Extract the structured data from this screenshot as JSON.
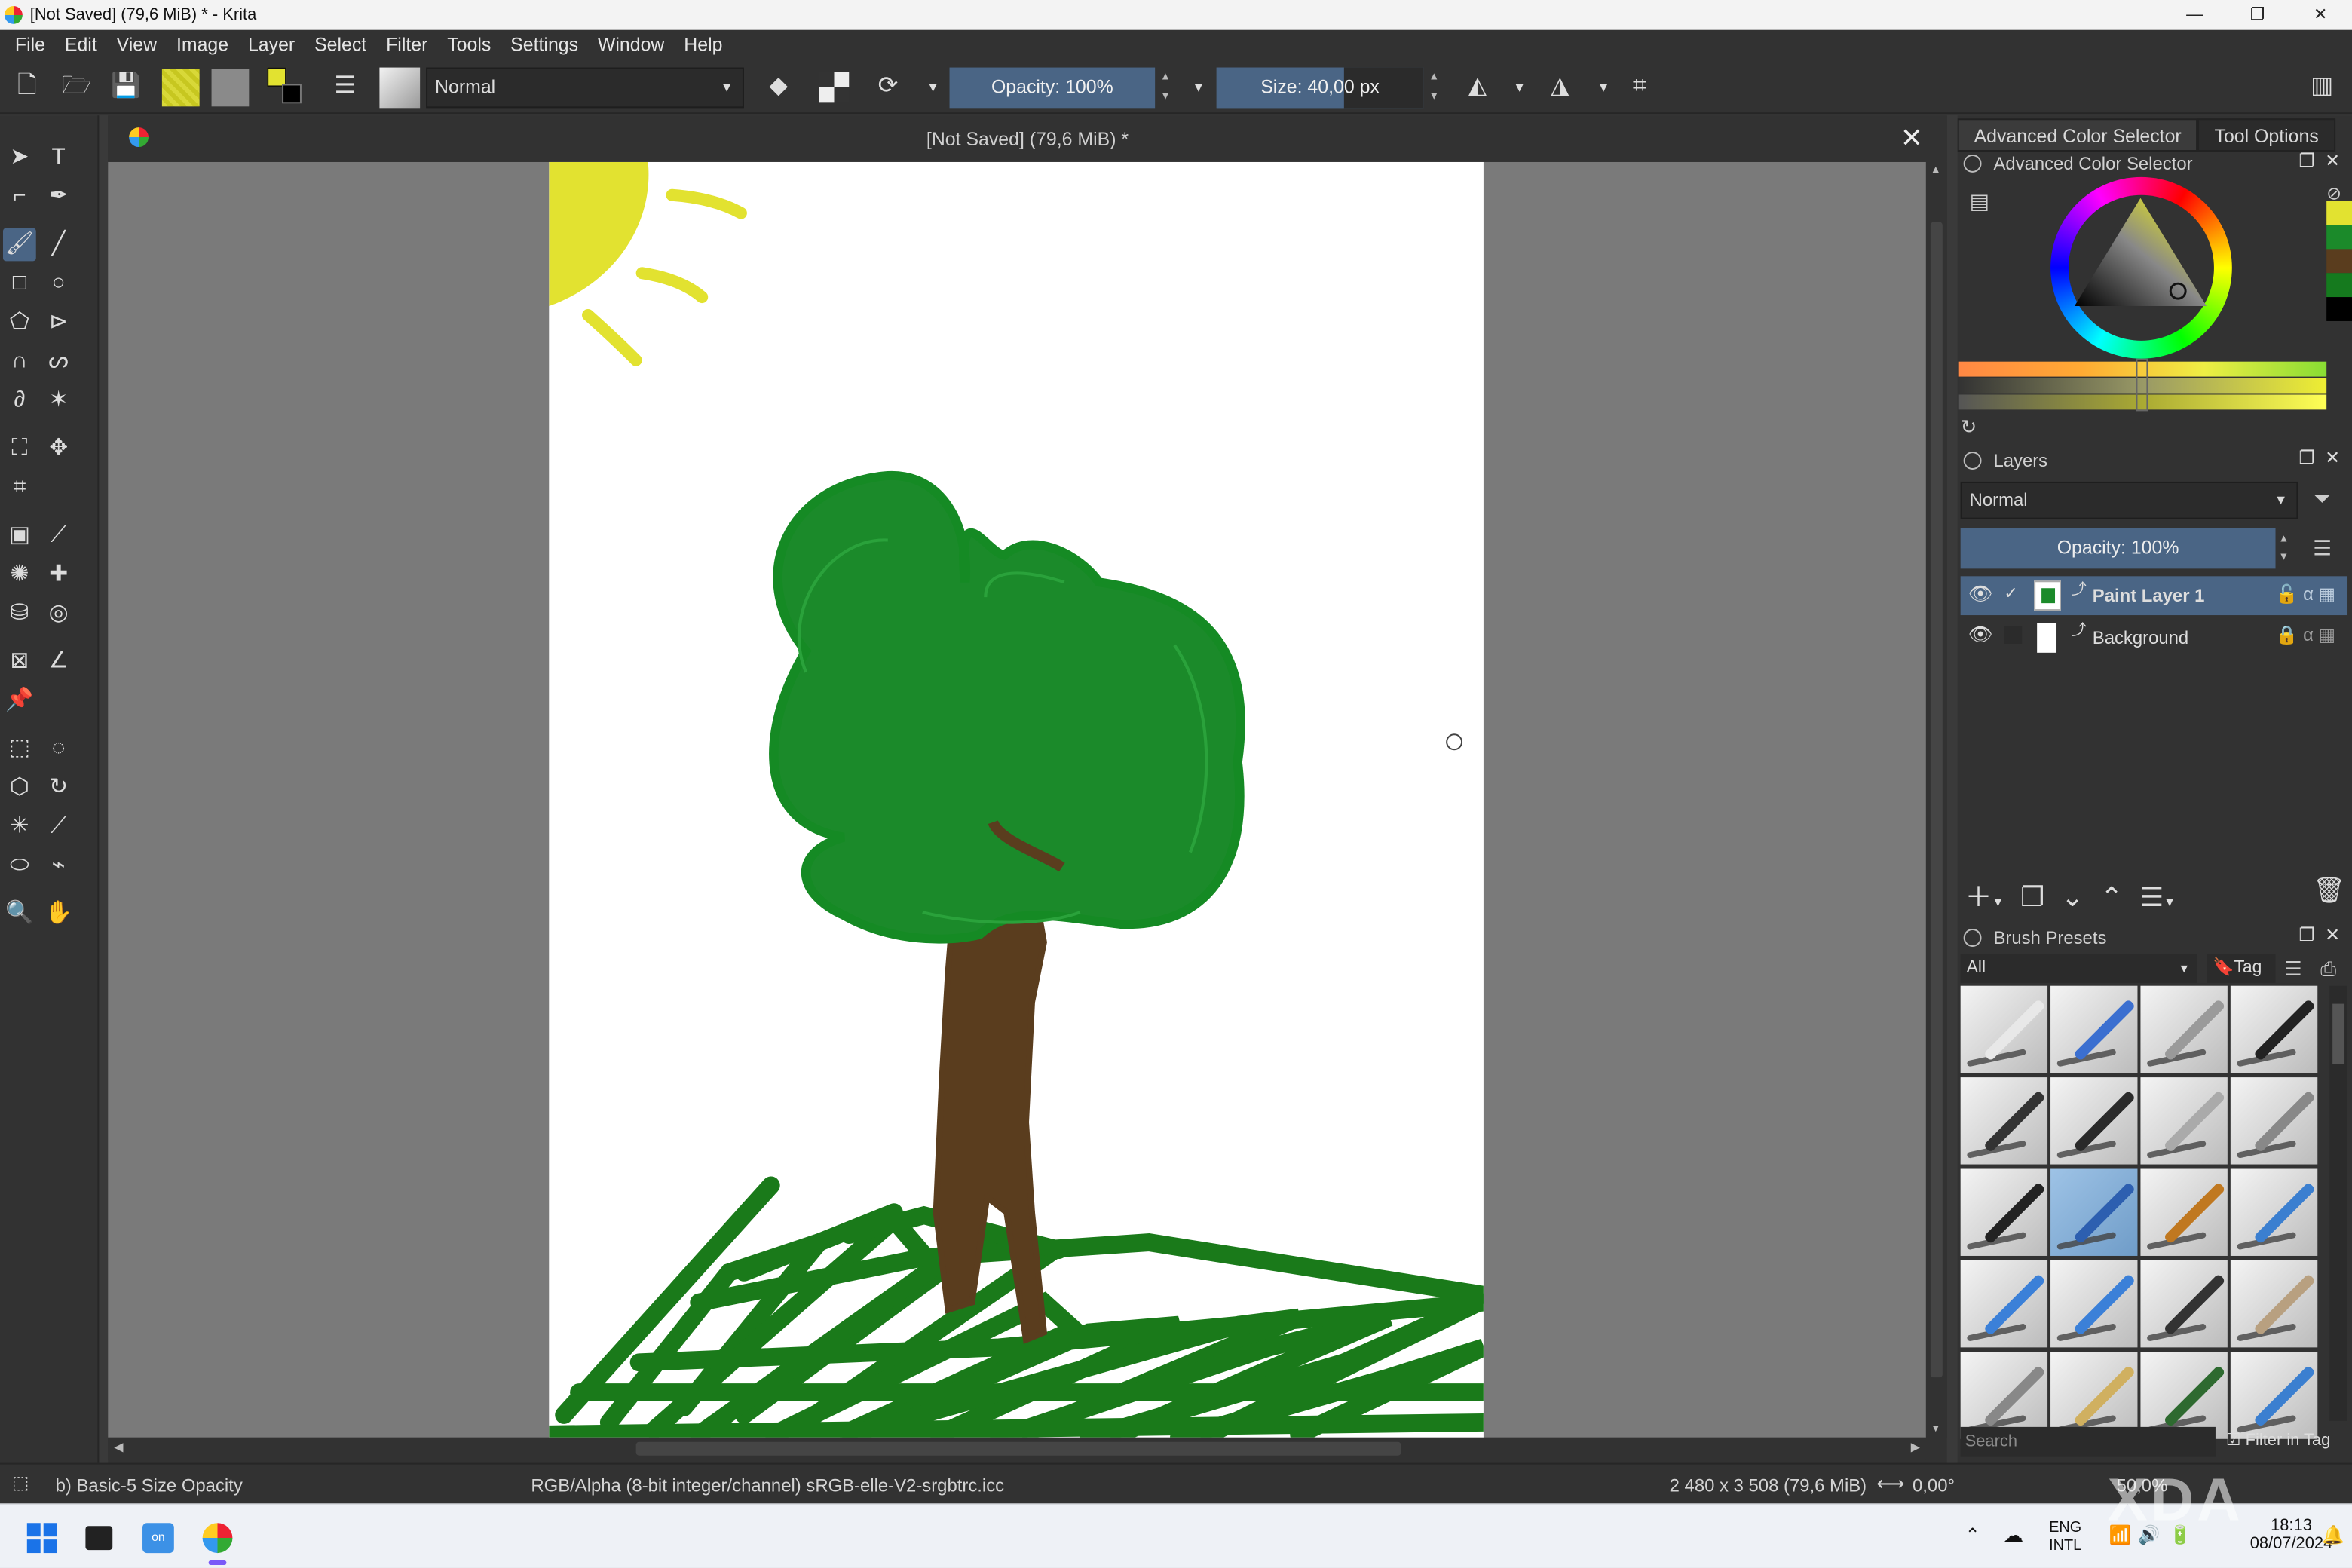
{
  "window": {
    "title": "[Not Saved]  (79,6 MiB) * - Krita",
    "controls": [
      "—",
      "❐",
      "✕"
    ]
  },
  "menu": [
    "File",
    "Edit",
    "View",
    "Image",
    "Layer",
    "Select",
    "Filter",
    "Tools",
    "Settings",
    "Window",
    "Help"
  ],
  "toolbar": {
    "blend_mode": "Normal",
    "opacity_label": "Opacity: 100%",
    "size_label": "Size: 40,00 px",
    "fg_color": "#e2e230",
    "bg_color": "#000000"
  },
  "document": {
    "tab_title": "[Not Saved]  (79,6 MiB) *"
  },
  "dock": {
    "tabs": [
      "Advanced Color Selector",
      "Tool Options"
    ],
    "color_selector_title": "Advanced Color Selector",
    "swatches": [
      "#e2e230",
      "#1b8a2a",
      "#5a3d1e",
      "#157a1e",
      "#000000"
    ],
    "layers": {
      "title": "Layers",
      "blend_mode": "Normal",
      "opacity_label": "Opacity:  100%",
      "items": [
        {
          "name": "Paint Layer 1",
          "selected": true
        },
        {
          "name": "Background",
          "selected": false
        }
      ]
    },
    "brush_presets": {
      "title": "Brush Presets",
      "filter": "All",
      "tag_label": "Tag",
      "search_placeholder": "Search",
      "filter_in_tag": "Filter in Tag",
      "presets": [
        {
          "color": "#e8e8e8"
        },
        {
          "color": "#3b6fd0"
        },
        {
          "color": "#9a9a9a"
        },
        {
          "color": "#222222"
        },
        {
          "color": "#333333"
        },
        {
          "color": "#2a2a2a"
        },
        {
          "color": "#aaaaaa"
        },
        {
          "color": "#888888"
        },
        {
          "color": "#222222"
        },
        {
          "color": "#2d5fb0"
        },
        {
          "color": "#c07820"
        },
        {
          "color": "#3b7fd0"
        },
        {
          "color": "#3b80d8"
        },
        {
          "color": "#3b80d8"
        },
        {
          "color": "#333333"
        },
        {
          "color": "#b8a080"
        },
        {
          "color": "#888888"
        },
        {
          "color": "#d0b060"
        },
        {
          "color": "#2e6a30"
        },
        {
          "color": "#3b7fd0"
        }
      ]
    }
  },
  "status": {
    "brush_name": "b) Basic-5 Size Opacity",
    "color_space": "RGB/Alpha (8-bit integer/channel)  sRGB-elle-V2-srgbtrc.icc",
    "dimensions": "2 480 x 3 508 (79,6 MiB)",
    "rotation": "0,00°",
    "zoom": "50,0%"
  },
  "taskbar": {
    "lang_line1": "ENG",
    "lang_line2": "INTL",
    "time": "18:13",
    "date": "08/07/2024"
  },
  "watermark": "XDA"
}
